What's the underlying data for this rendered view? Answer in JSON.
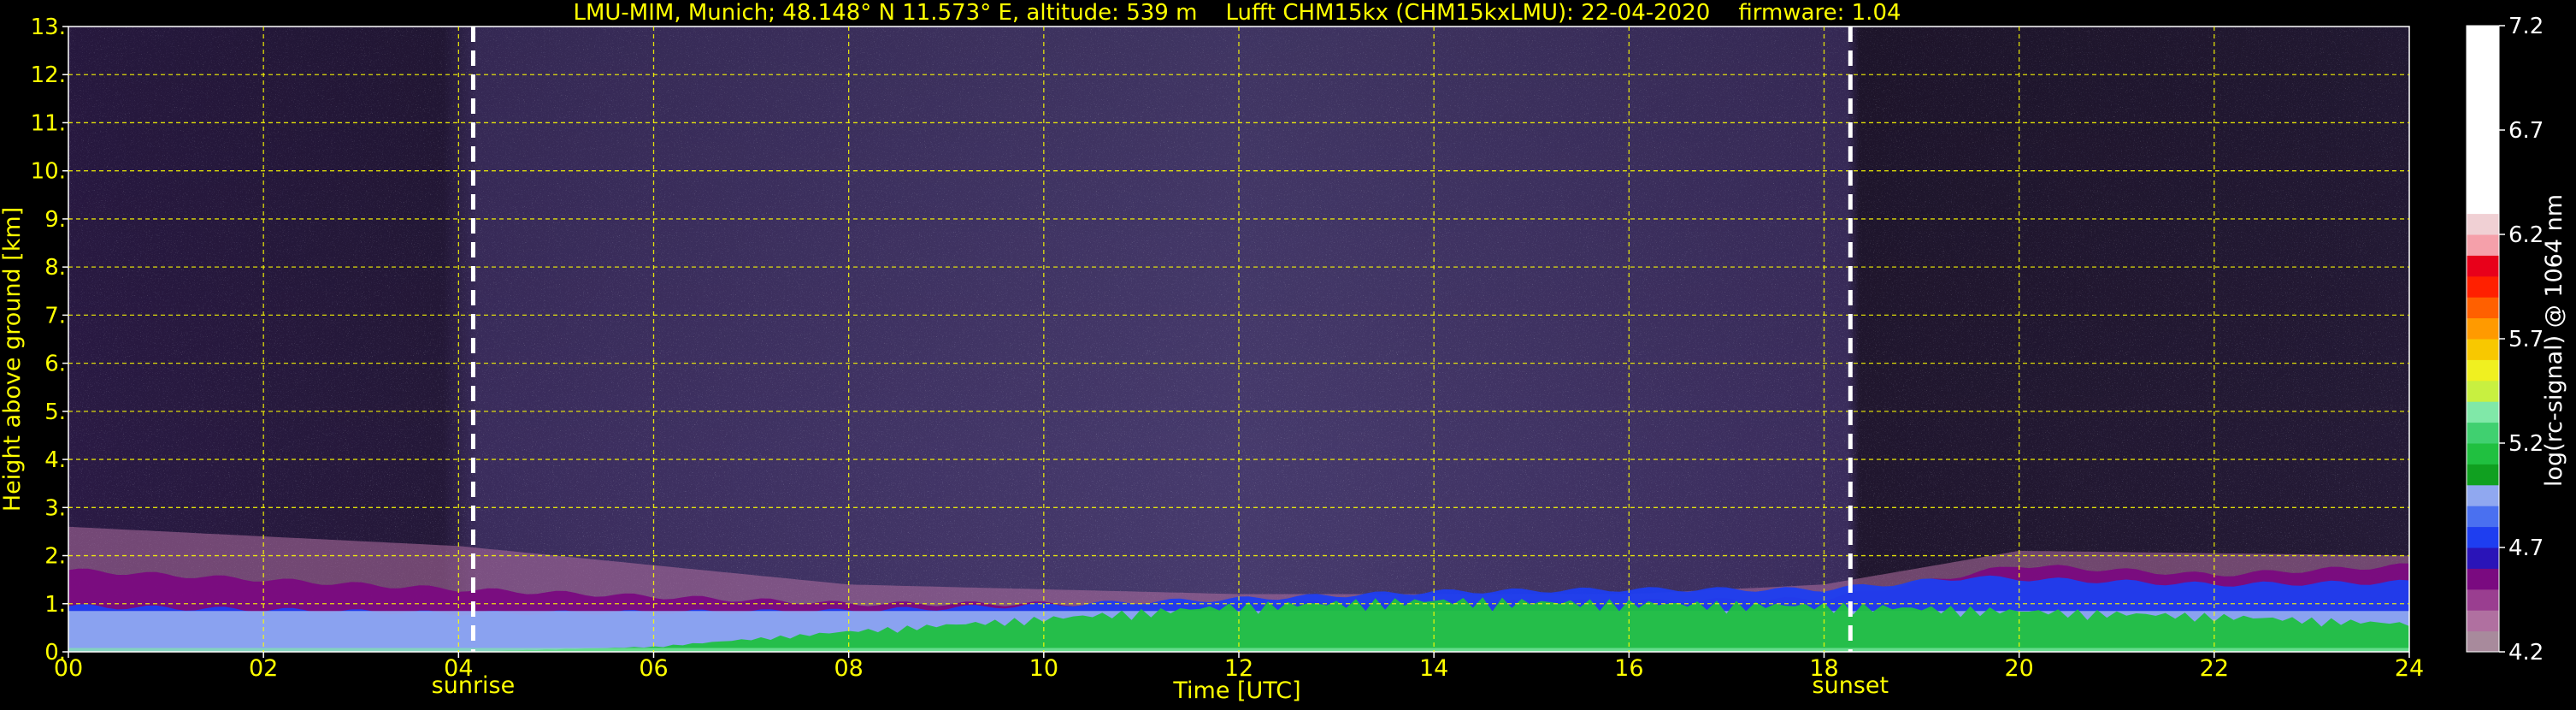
{
  "chart_data": {
    "type": "heatmap",
    "title": "LMU-MIM, Munich; 48.148° N 11.573° E, altitude: 539 m    Lufft CHM15kx (CHM15kxLMU): 22-04-2020    firmware: 1.04",
    "xlabel": "Time [UTC]",
    "ylabel": "Height above ground [km]",
    "xlim": [
      0,
      24
    ],
    "ylim": [
      0,
      13
    ],
    "x_ticks": [
      0,
      2,
      4,
      6,
      8,
      10,
      12,
      14,
      16,
      18,
      20,
      22,
      24
    ],
    "x_tick_labels": [
      "00",
      "02",
      "04",
      "06",
      "08",
      "10",
      "12",
      "14",
      "16",
      "18",
      "20",
      "22",
      "24"
    ],
    "y_ticks": [
      0,
      1,
      2,
      3,
      4,
      5,
      6,
      7,
      8,
      9,
      10,
      11,
      12,
      13
    ],
    "y_tick_labels": [
      "0.",
      "1.",
      "2.",
      "3.",
      "4.",
      "5.",
      "6.",
      "7.",
      "8.",
      "9.",
      "10.",
      "11.",
      "12.",
      "13."
    ],
    "grid": true,
    "annotations": [
      {
        "text": "sunrise",
        "x": 4.15
      },
      {
        "text": "sunset",
        "x": 18.27
      }
    ],
    "colorbar": {
      "label": "log(rc-signal) @ 1064 nm",
      "range": [
        4.2,
        7.2
      ],
      "tick_values": [
        4.2,
        4.7,
        5.2,
        5.7,
        6.2,
        6.7,
        7.2
      ],
      "tick_labels": [
        "4.2",
        "4.7",
        "5.2",
        "5.7",
        "6.2",
        "6.7",
        "7.2"
      ],
      "colors": [
        {
          "from": 4.2,
          "to": 4.3,
          "color": "#a88a9c"
        },
        {
          "from": 4.3,
          "to": 4.4,
          "color": "#b070a0"
        },
        {
          "from": 4.4,
          "to": 4.5,
          "color": "#9a3e90"
        },
        {
          "from": 4.5,
          "to": 4.6,
          "color": "#7a0a80"
        },
        {
          "from": 4.6,
          "to": 4.7,
          "color": "#2a14b8"
        },
        {
          "from": 4.7,
          "to": 4.8,
          "color": "#1e3ef0"
        },
        {
          "from": 4.8,
          "to": 4.9,
          "color": "#4a70f0"
        },
        {
          "from": 4.9,
          "to": 5.0,
          "color": "#90a8f0"
        },
        {
          "from": 5.0,
          "to": 5.1,
          "color": "#10a020"
        },
        {
          "from": 5.1,
          "to": 5.2,
          "color": "#20c040"
        },
        {
          "from": 5.2,
          "to": 5.3,
          "color": "#40d070"
        },
        {
          "from": 5.3,
          "to": 5.4,
          "color": "#80e8a8"
        },
        {
          "from": 5.4,
          "to": 5.5,
          "color": "#c8f040"
        },
        {
          "from": 5.5,
          "to": 5.6,
          "color": "#f0f020"
        },
        {
          "from": 5.6,
          "to": 5.7,
          "color": "#f8c800"
        },
        {
          "from": 5.7,
          "to": 5.8,
          "color": "#ff9a00"
        },
        {
          "from": 5.8,
          "to": 5.9,
          "color": "#ff6000"
        },
        {
          "from": 5.9,
          "to": 6.0,
          "color": "#ff2000"
        },
        {
          "from": 6.0,
          "to": 6.1,
          "color": "#e8001a"
        },
        {
          "from": 6.1,
          "to": 6.2,
          "color": "#f5a0aa"
        },
        {
          "from": 6.2,
          "to": 6.3,
          "color": "#f0d0d4"
        },
        {
          "from": 6.3,
          "to": 7.2,
          "color": "#ffffff"
        }
      ]
    },
    "layers": [
      {
        "name": "near-ground",
        "bottom_km": [
          0.1,
          0.1
        ],
        "top_km": [
          0.85,
          0.85
        ],
        "color": "#90a8f0"
      },
      {
        "name": "aerosol-layer",
        "x": [
          0,
          4,
          6,
          8,
          10,
          12,
          14,
          16,
          18,
          20,
          22,
          24
        ],
        "bottom_km": [
          0.1,
          0.1,
          0.1,
          0.1,
          0.1,
          0.1,
          0.1,
          0.1,
          0.1,
          0.1,
          0.1,
          0.1
        ],
        "top_km": [
          0.0,
          0.0,
          0.1,
          0.4,
          0.65,
          0.9,
          1.0,
          0.95,
          0.9,
          0.8,
          0.7,
          0.55
        ],
        "color": "#20c040"
      },
      {
        "name": "blue-band",
        "x": [
          0,
          4,
          8,
          12,
          14,
          16,
          18,
          19.5,
          22,
          24
        ],
        "top_km": [
          0.95,
          0.8,
          0.85,
          1.1,
          1.25,
          1.3,
          1.3,
          1.55,
          1.4,
          1.45
        ],
        "color": "#1e3ef0"
      },
      {
        "name": "purple-band",
        "x": [
          0,
          4,
          8,
          12,
          16,
          18,
          20,
          22,
          24
        ],
        "top_km": [
          1.7,
          1.3,
          1.0,
          1.0,
          1.05,
          1.1,
          1.8,
          1.6,
          1.8
        ],
        "color": "#7a0a80"
      },
      {
        "name": "upper-haze",
        "x": [
          0,
          4,
          8,
          12,
          16,
          18,
          20,
          24
        ],
        "top_km": [
          2.6,
          2.2,
          1.4,
          1.2,
          1.2,
          1.4,
          2.1,
          2.0
        ],
        "color": "#b070a0"
      }
    ]
  }
}
